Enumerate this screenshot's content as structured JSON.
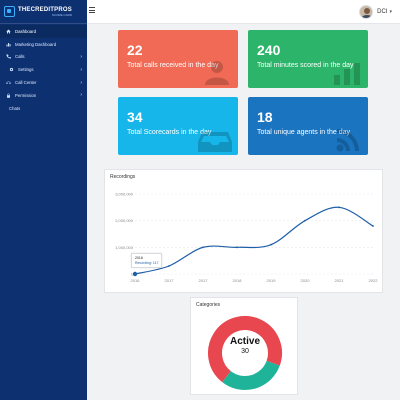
{
  "brand": {
    "title": "THECREDITPROS",
    "subtitle": "SCORE CARD"
  },
  "sidebar": {
    "items": [
      {
        "label": "Dashboard",
        "icon": "home-icon",
        "active": true
      },
      {
        "label": "Marketing Dashboard",
        "icon": "chart-icon"
      },
      {
        "label": "Calls",
        "icon": "phone-icon",
        "caret": "›"
      },
      {
        "label": "Settings",
        "icon": "gear-icon",
        "caret": "›"
      },
      {
        "label": "Call Center",
        "icon": "headset-icon",
        "caret": "›"
      },
      {
        "label": "Permission",
        "icon": "lock-icon",
        "caret": "›"
      },
      {
        "label": "Chats",
        "icon": ""
      }
    ]
  },
  "user": {
    "name": "DCI",
    "caret": "▾"
  },
  "cards": [
    {
      "value": "22",
      "label": "Total calls received in the day",
      "color": "#f06a55",
      "icon": "user-icon"
    },
    {
      "value": "240",
      "label": "Total minutes scored in the day",
      "color": "#2cb56a",
      "icon": "bar-chart-icon"
    },
    {
      "value": "34",
      "label": "Total Scorecards in the day",
      "color": "#16b6ea",
      "icon": "inbox-icon"
    },
    {
      "value": "18",
      "label": "Total unique agents in the day",
      "color": "#1a74c0",
      "icon": "rss-icon"
    }
  ],
  "recordings": {
    "title": "Recordings",
    "tooltip": {
      "year": "2016",
      "text": "Recording: 117"
    }
  },
  "categories": {
    "title": "Categories",
    "center_label": "Active",
    "center_value": "30"
  },
  "chart_data": [
    {
      "type": "line",
      "title": "Recordings",
      "x": [
        "2016",
        "2017",
        "2017",
        "2018",
        "2019",
        "2020",
        "2021",
        "2022"
      ],
      "y_ticks": [
        "3,000,000",
        "2,000,000",
        "1,000,000",
        "1"
      ],
      "series": [
        {
          "values": [
            117,
            300000,
            1000000,
            1000000,
            1100000,
            2000000,
            2500000,
            1800000
          ],
          "color": "#1f5fa8"
        }
      ]
    },
    {
      "type": "pie",
      "title": "Categories",
      "labels": [
        "Active"
      ],
      "slices": [
        {
          "value": 70,
          "color": "#e8474f"
        },
        {
          "value": 30,
          "color": "#1fb49a"
        }
      ]
    }
  ]
}
